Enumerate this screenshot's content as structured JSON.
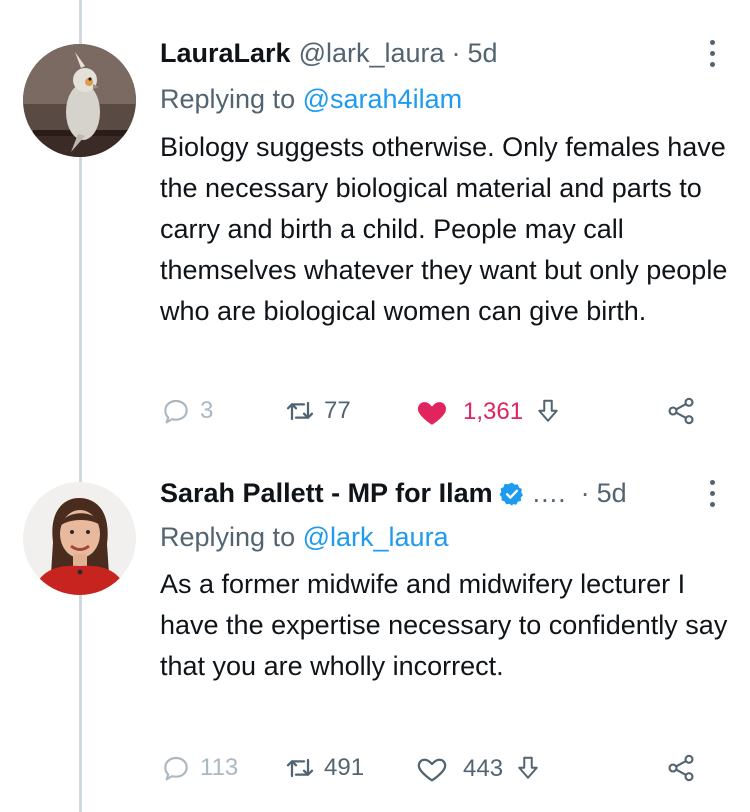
{
  "tweets": [
    {
      "author_name": "LauraLark",
      "handle": "@lark_laura",
      "separator": "·",
      "time": "5d",
      "replying_to_prefix": "Replying to",
      "replying_to_handle": "@sarah4ilam",
      "text": "Biology suggests otherwise.  Only females have the necessary biological material and parts to carry and birth a child.  People may call themselves whatever they want but only people who are biological women can give birth.",
      "replies": "3",
      "retweets": "77",
      "likes": "1,361",
      "liked": true,
      "avatar_icon": "cockatiel-avatar"
    },
    {
      "author_name": "Sarah Pallett - MP for Ilam",
      "verified": true,
      "name_truncation": "....",
      "separator": "·",
      "time": "5d",
      "replying_to_prefix": "Replying to",
      "replying_to_handle": "@lark_laura",
      "text": "As a former midwife and midwifery lecturer I have the expertise necessary to confidently say that you are wholly incorrect.",
      "replies": "113",
      "retweets": "491",
      "likes": "443",
      "liked": false,
      "avatar_icon": "woman-portrait-avatar"
    }
  ],
  "colors": {
    "link": "#1d9bf0",
    "like_active": "#e0245e",
    "muted": "#536471",
    "thread_line": "#cfd9de"
  }
}
